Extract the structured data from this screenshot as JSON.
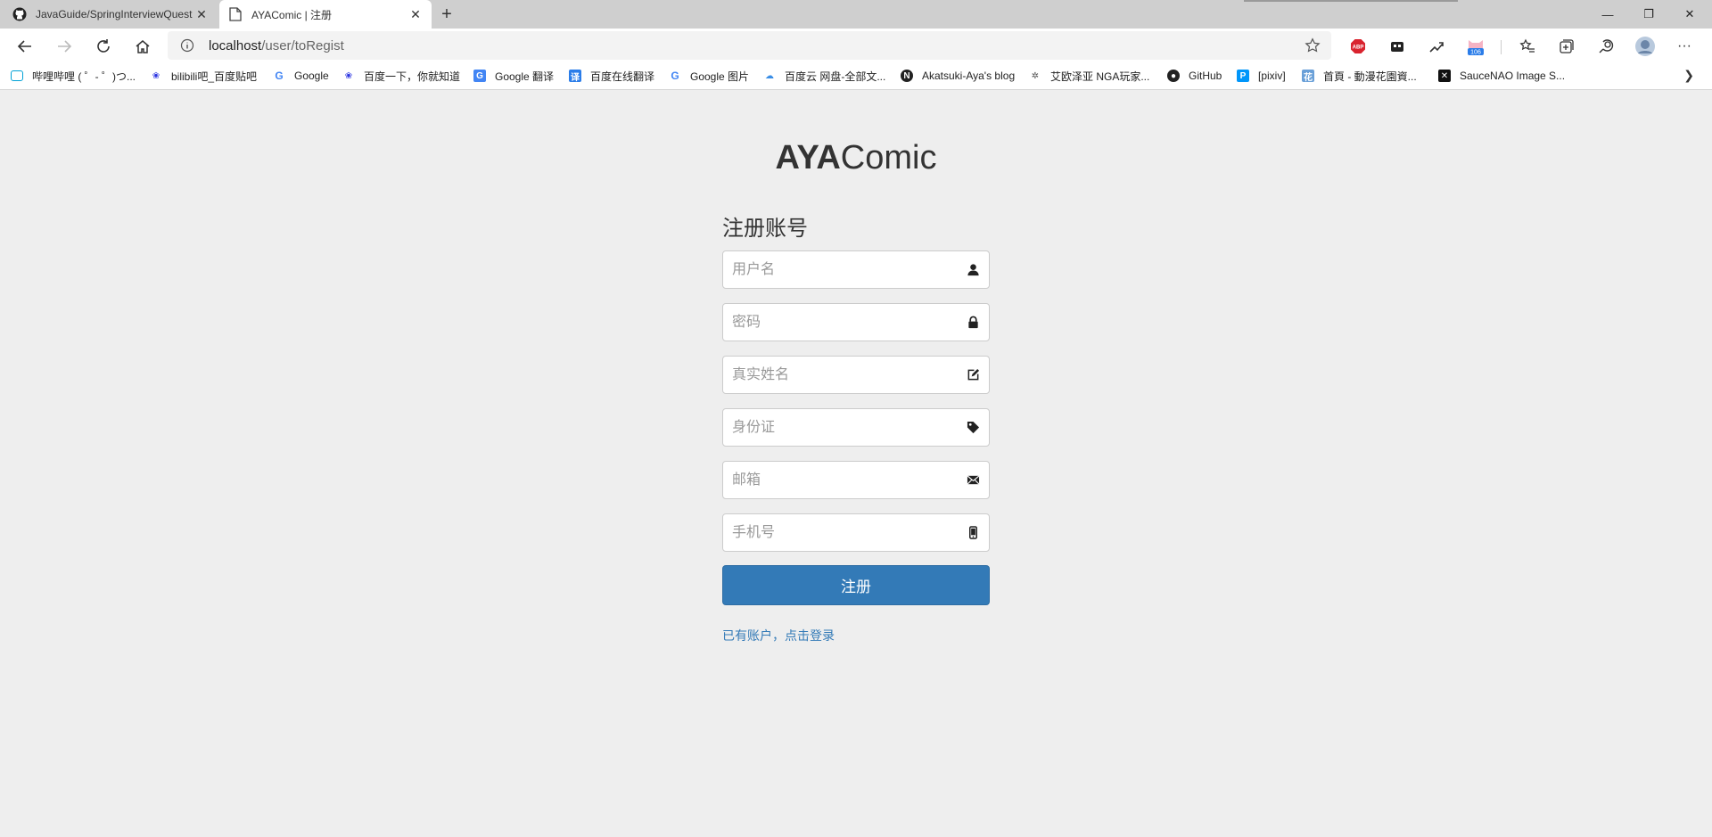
{
  "browser": {
    "tabs": [
      {
        "title": "JavaGuide/SpringInterviewQuest",
        "active": false
      },
      {
        "title": "AYAComic | 注册",
        "active": true
      }
    ],
    "address": {
      "host": "localhost",
      "path": "/user/toRegist"
    },
    "extensions": [
      {
        "name": "adblock-icon",
        "label": "ABP"
      },
      {
        "name": "extension-icon"
      },
      {
        "name": "chart-icon"
      },
      {
        "name": "cat-icon",
        "badge": "106"
      },
      {
        "name": "favorites-icon"
      },
      {
        "name": "collections-icon"
      },
      {
        "name": "feedback-icon"
      },
      {
        "name": "profile-avatar-icon"
      },
      {
        "name": "more-icon",
        "label": "···"
      }
    ],
    "bookmarks": [
      {
        "label": "哔哩哔哩 ( ゜- ゜)つ...",
        "icon": "bilibili-icon",
        "color": "#00a1d6"
      },
      {
        "label": "bilibili吧_百度贴吧",
        "icon": "baidu-paw-icon",
        "color": "#2932e1"
      },
      {
        "label": "Google",
        "icon": "google-icon",
        "color": "#4285f4"
      },
      {
        "label": "百度一下，你就知道",
        "icon": "baidu-paw-icon",
        "color": "#2932e1"
      },
      {
        "label": "Google 翻译",
        "icon": "google-translate-icon",
        "color": "#4285f4"
      },
      {
        "label": "百度在线翻译",
        "icon": "baidu-translate-icon",
        "color": "#2b7de9"
      },
      {
        "label": "Google 图片",
        "icon": "google-icon",
        "color": "#4285f4"
      },
      {
        "label": "百度云 网盘-全部文...",
        "icon": "baidu-cloud-icon",
        "color": "#3a8ee6"
      },
      {
        "label": "Akatsuki-Aya's blog",
        "icon": "notion-icon",
        "color": "#222222"
      },
      {
        "label": "艾欧泽亚 NGA玩家...",
        "icon": "nga-icon",
        "color": "#555555"
      },
      {
        "label": "GitHub",
        "icon": "github-icon",
        "color": "#222222"
      },
      {
        "label": "[pixiv]",
        "icon": "pixiv-icon",
        "color": "#0096fa"
      },
      {
        "label": "首頁 - 動漫花園資...",
        "icon": "dmhy-icon",
        "color": "#6aa0d8"
      },
      {
        "label": "SauceNAO Image S...",
        "icon": "saucenao-icon",
        "color": "#111111"
      }
    ]
  },
  "page": {
    "brand_bold": "AYA",
    "brand_rest": "Comic",
    "form_title": "注册账号",
    "fields": [
      {
        "name": "username-input",
        "placeholder": "用户名",
        "icon": "user-icon"
      },
      {
        "name": "password-input",
        "placeholder": "密码",
        "icon": "lock-icon"
      },
      {
        "name": "realname-input",
        "placeholder": "真实姓名",
        "icon": "edit-icon"
      },
      {
        "name": "idcard-input",
        "placeholder": "身份证",
        "icon": "tag-icon"
      },
      {
        "name": "email-input",
        "placeholder": "邮箱",
        "icon": "envelope-icon"
      },
      {
        "name": "phone-input",
        "placeholder": "手机号",
        "icon": "phone-icon"
      }
    ],
    "submit_label": "注册",
    "login_link": "已有账户，点击登录",
    "accent_color": "#337ab7"
  }
}
